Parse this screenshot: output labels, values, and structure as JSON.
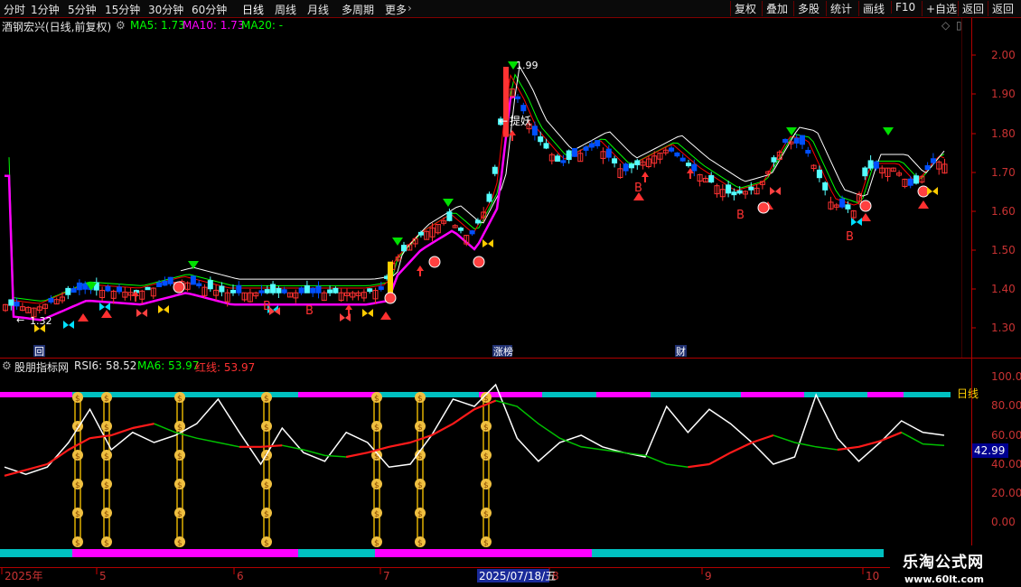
{
  "toolbar": {
    "left_items": [
      {
        "label": "分时"
      },
      {
        "label": "1分钟"
      },
      {
        "label": "5分钟"
      },
      {
        "label": "15分钟"
      },
      {
        "label": "30分钟"
      },
      {
        "label": "60分钟"
      },
      {
        "label": "日线",
        "active": true
      },
      {
        "label": "周线"
      },
      {
        "label": "月线"
      },
      {
        "label": "多周期"
      },
      {
        "label": "更多"
      }
    ],
    "right_items": [
      {
        "label": "复权"
      },
      {
        "label": "叠加"
      },
      {
        "label": "多股"
      },
      {
        "label": "统计"
      },
      {
        "label": "画线"
      },
      {
        "label": "F10"
      },
      {
        "label": "+自选"
      },
      {
        "label": "返回"
      }
    ]
  },
  "main_chart": {
    "title": "酒钢宏兴(日线,前复权)",
    "ma5_label": "MA5: 1.73",
    "ma10_label": "MA10: 1.73",
    "ma20_label": "MA20: -",
    "price_axis": [
      "2.00",
      "1.90",
      "1.80",
      "1.70",
      "1.60",
      "1.50",
      "1.40",
      "1.30"
    ],
    "high_annotation": "1.99",
    "low_annotation": "1.32",
    "event_marker": "提妖",
    "b_marker": "B",
    "flags": [
      "回",
      "涨榜",
      "财"
    ],
    "colors": {
      "up": "#ff3232",
      "down": "#54ffff",
      "ma_white": "#ffffff",
      "ma_green": "#00ff00",
      "ma_red": "#ff0000",
      "magenta": "#ff00ff",
      "axis": "#c00000"
    }
  },
  "sub_chart": {
    "title": "股朋指标网",
    "rsi_label": "RSI6: 58.52",
    "ma6_label": "MA6: 53.97",
    "red_label": "红线: 53.97",
    "axis_labels": [
      "100.00",
      "80.00",
      "60.00",
      "40.00",
      "20.00",
      "0.00"
    ],
    "current_value": "42.99",
    "right_tag": "日线"
  },
  "time_axis": {
    "labels": [
      "2025年",
      "5",
      "6",
      "7",
      "8",
      "9",
      "10"
    ],
    "cursor_date": "2025/07/18/五"
  },
  "chart_data": {
    "type": "line",
    "title": "",
    "x": [
      "2025年",
      "5",
      "6",
      "7",
      "8",
      "9",
      "10"
    ],
    "series": [
      {
        "name": "RSI6",
        "values": [
          38,
          33,
          38,
          55,
          78,
          50,
          62,
          55,
          60,
          68,
          85,
          62,
          40,
          65,
          48,
          42,
          62,
          55,
          38,
          40,
          60,
          85,
          80,
          95,
          58,
          42,
          55,
          60,
          52,
          48,
          45,
          80,
          62,
          78,
          68,
          55,
          40,
          45,
          88,
          58,
          42,
          55,
          70,
          62,
          60
        ]
      },
      {
        "name": "MA6",
        "values": [
          32,
          36,
          40,
          50,
          58,
          60,
          65,
          68,
          62,
          58,
          55,
          52,
          52,
          53,
          50,
          46,
          45,
          48,
          52,
          55,
          60,
          68,
          78,
          84,
          80,
          68,
          58,
          52,
          50,
          48,
          46,
          40,
          38,
          40,
          48,
          55,
          60,
          55,
          52,
          50,
          52,
          56,
          62,
          54,
          53
        ]
      }
    ],
    "ylim": [
      -10,
      110
    ],
    "grid": false,
    "legend_placement": "top-left"
  }
}
